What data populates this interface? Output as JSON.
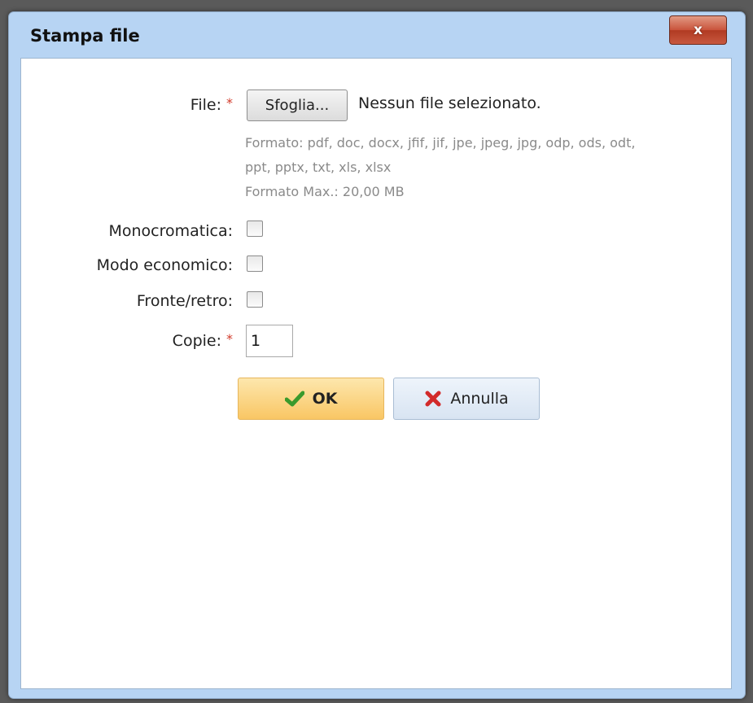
{
  "dialog": {
    "title": "Stampa file",
    "close_label": "x"
  },
  "form": {
    "file": {
      "label": "File:",
      "required_mark": "*",
      "browse_label": "Sfoglia...",
      "status": "Nessun file selezionato.",
      "format_line1": "Formato: pdf, doc, docx, jfif, jif, jpe, jpeg, jpg, odp, ods, odt,",
      "format_line2": "ppt, pptx, txt, xls, xlsx",
      "max_size": "Formato Max.: 20,00 MB"
    },
    "monochrome": {
      "label": "Monocromatica:",
      "checked": false
    },
    "economy": {
      "label": "Modo economico:",
      "checked": false
    },
    "duplex": {
      "label": "Fronte/retro:",
      "checked": false
    },
    "copies": {
      "label": "Copie:",
      "required_mark": "*",
      "value": "1"
    }
  },
  "buttons": {
    "ok": {
      "label": "OK",
      "icon": "checkmark-icon",
      "color": "#3a9a2c"
    },
    "cancel": {
      "label": "Annulla",
      "icon": "red-x-icon",
      "color": "#d22a2a"
    }
  }
}
